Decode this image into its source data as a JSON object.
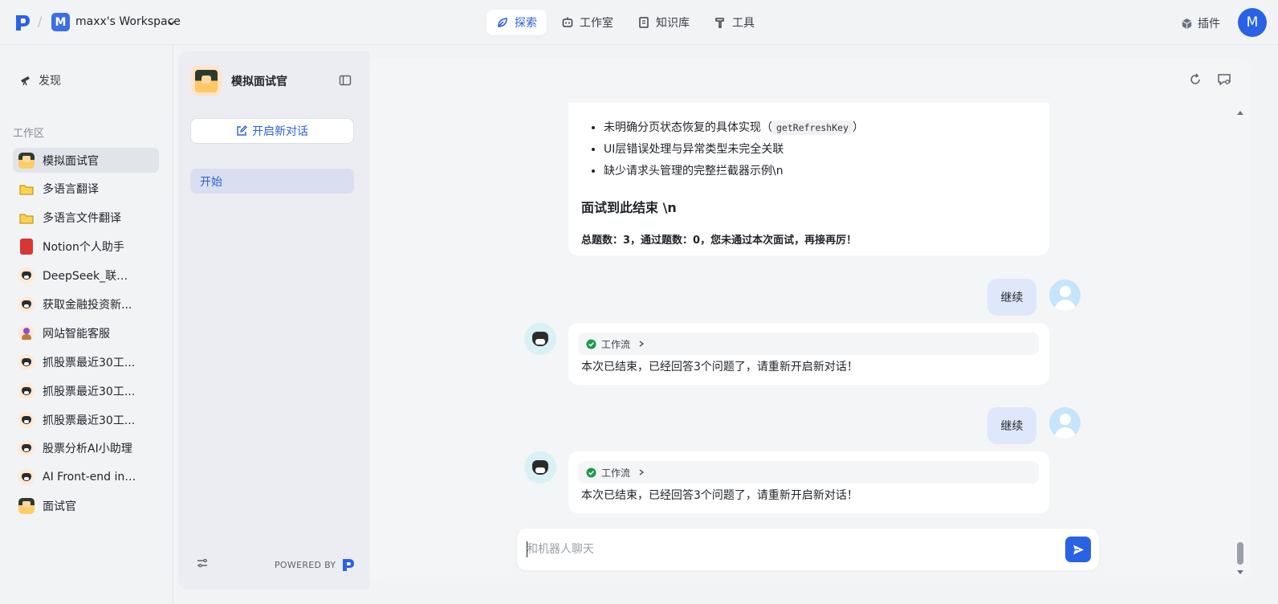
{
  "topbar": {
    "workspace_initial": "M",
    "workspace_name": "maxx's Workspace",
    "nav": [
      {
        "label": "探索",
        "icon": "leaf-icon",
        "active": true
      },
      {
        "label": "工作室",
        "icon": "robot-icon",
        "active": false
      },
      {
        "label": "知识库",
        "icon": "book-icon",
        "active": false
      },
      {
        "label": "工具",
        "icon": "hammer-icon",
        "active": false
      }
    ],
    "plugin_label": "插件",
    "user_initial": "M",
    "accent": "#2a62e6"
  },
  "sidebar": {
    "discover_label": "发现",
    "workspace_section": "工作区",
    "items": [
      {
        "label": "模拟面试官",
        "icon": "pixel-art-icon",
        "active": true
      },
      {
        "label": "多语言翻译",
        "icon": "folder-icon"
      },
      {
        "label": "多语言文件翻译",
        "icon": "folder-icon"
      },
      {
        "label": "Notion个人助手",
        "icon": "red-book-icon"
      },
      {
        "label": "DeepSeek_联网...",
        "icon": "bear-icon"
      },
      {
        "label": "获取金融投资新...",
        "icon": "bear-icon"
      },
      {
        "label": "网站智能客服",
        "icon": "person-icon"
      },
      {
        "label": "抓股票最近30工...",
        "icon": "bear-icon"
      },
      {
        "label": "抓股票最近30工...",
        "icon": "bear-icon"
      },
      {
        "label": "抓股票最近30工...",
        "icon": "bear-icon"
      },
      {
        "label": "股票分析AI小助理",
        "icon": "bear-icon"
      },
      {
        "label": "AI Front-end int...",
        "icon": "bear-icon"
      },
      {
        "label": "面试官",
        "icon": "pixel-art-icon"
      }
    ]
  },
  "panel": {
    "title": "模拟面试官",
    "new_chat_label": "开启新对话",
    "conversations": [
      {
        "label": "开始",
        "active": true
      }
    ],
    "powered_by": "POWERED BY"
  },
  "chat": {
    "first_card": {
      "bullets": [
        {
          "text": "未明确分页状态恢复的具体实现（",
          "code": "getRefreshKey",
          "tail": "）"
        },
        {
          "text": "UI层错误处理与异常类型未完全关联",
          "code": "",
          "tail": ""
        },
        {
          "text": "缺少请求头管理的完整拦截器示例\\n",
          "code": "",
          "tail": ""
        }
      ],
      "heading": "面试到此结束 \\n",
      "summary": "总题数：3，通过题数：0，您未通过本次面试，再接再厉！"
    },
    "messages": [
      {
        "role": "user",
        "text": "继续"
      },
      {
        "role": "bot",
        "workflow_label": "工作流",
        "text": "本次已结束，已经回答3个问题了，请重新开启新对话！"
      },
      {
        "role": "user",
        "text": "继续"
      },
      {
        "role": "bot",
        "workflow_label": "工作流",
        "text": "本次已结束，已经回答3个问题了，请重新开启新对话！"
      }
    ],
    "input_placeholder": "和机器人聊天"
  }
}
